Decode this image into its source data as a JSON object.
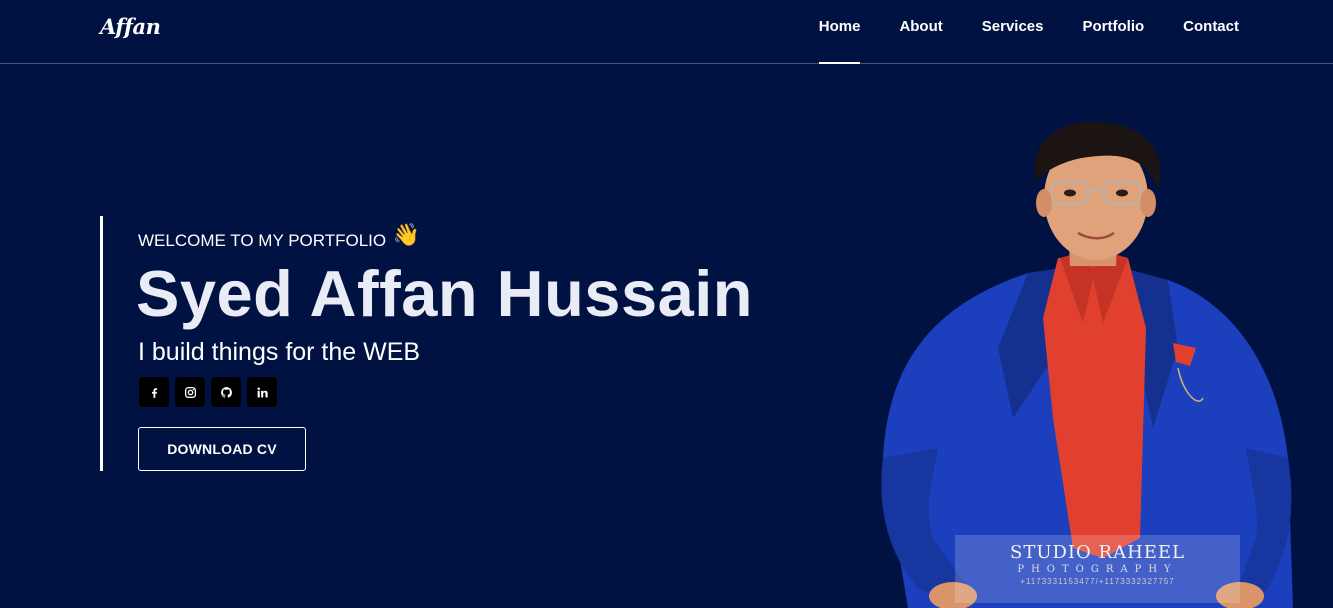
{
  "brand": {
    "logo": "Affan"
  },
  "nav": {
    "items": [
      {
        "label": "Home",
        "active": true
      },
      {
        "label": "About",
        "active": false
      },
      {
        "label": "Services",
        "active": false
      },
      {
        "label": "Portfolio",
        "active": false
      },
      {
        "label": "Contact",
        "active": false
      }
    ]
  },
  "hero": {
    "welcome": "WELCOME TO MY PORTFOLIO",
    "wave_emoji": "👋",
    "name": "Syed Affan Hussain",
    "tagline": "I build things for the WEB",
    "socials": [
      {
        "icon": "facebook-icon"
      },
      {
        "icon": "instagram-icon"
      },
      {
        "icon": "github-icon"
      },
      {
        "icon": "linkedin-icon"
      }
    ],
    "cta_label": "DOWNLOAD CV"
  },
  "photo_watermark": {
    "title": "STUDIO RAHEEL",
    "subtitle": "PHOTOGRAPHY",
    "phone": "+1173331153477/+1173332327757"
  },
  "colors": {
    "background": "#001242",
    "text": "#ffffff",
    "social_bg": "#000000",
    "jacket": "#1c3fbe",
    "shirt": "#e2402f"
  }
}
